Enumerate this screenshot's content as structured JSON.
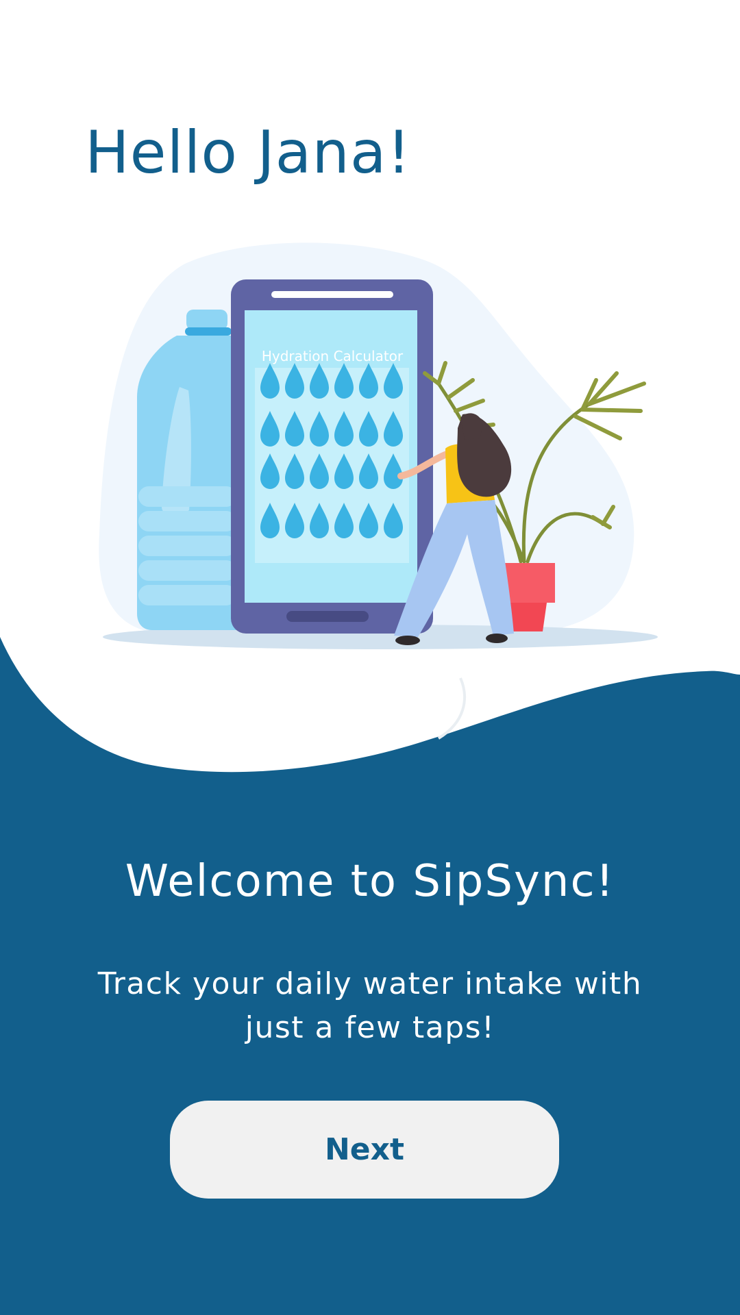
{
  "greeting": "Hello Jana!",
  "illustration": {
    "screen_title": "Hydration Calculator",
    "icons": [
      "water-bottle-icon",
      "phone-icon",
      "water-drop-icon",
      "woman-figure-icon",
      "potted-plant-icon"
    ]
  },
  "welcome": {
    "title": "Welcome to SipSync!",
    "subtitle": "Track your daily water intake with just a few taps!"
  },
  "actions": {
    "next_label": "Next"
  },
  "colors": {
    "primary": "#125f8c",
    "background": "#ffffff",
    "button_bg": "#f1f1f1",
    "drop": "#3bb3e3",
    "phone_frame": "#5f64a4",
    "phone_screen": "#aee9f9",
    "pot": "#f24753",
    "shirt": "#f7c316",
    "pants": "#a7c6f2",
    "hair": "#4b3b3d"
  }
}
